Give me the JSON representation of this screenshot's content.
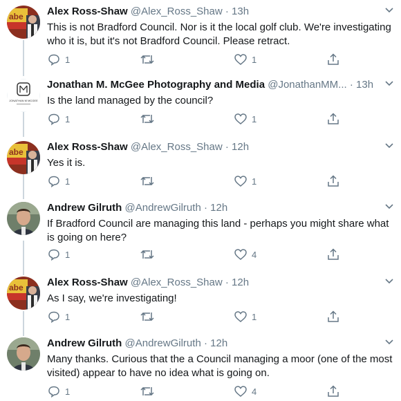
{
  "tweets": [
    {
      "name": "Alex Ross-Shaw",
      "handle": "@Alex_Ross_Shaw",
      "sep": "·",
      "time": "13h",
      "text": "This is not Bradford Council. Nor is it the local golf club. We're investigating who it is, but it's not Bradford Council. Please retract.",
      "replies": "1",
      "retweets": "",
      "likes": "1"
    },
    {
      "name": "Jonathan M. McGee Photography and Media",
      "handle": "@JonathanMM...",
      "sep": "·",
      "time": "13h",
      "logo_text": "JONATHAN M MCGEE",
      "text": "Is the land managed by the council?",
      "replies": "1",
      "retweets": "",
      "likes": "1"
    },
    {
      "name": "Alex Ross-Shaw",
      "handle": "@Alex_Ross_Shaw",
      "sep": "·",
      "time": "12h",
      "text": "Yes it is.",
      "replies": "1",
      "retweets": "",
      "likes": "1"
    },
    {
      "name": "Andrew Gilruth",
      "handle": "@AndrewGilruth",
      "sep": "·",
      "time": "12h",
      "text": "If Bradford Council are managing this land - perhaps you might share what is going on here?",
      "replies": "1",
      "retweets": "",
      "likes": "4"
    },
    {
      "name": "Alex Ross-Shaw",
      "handle": "@Alex_Ross_Shaw",
      "sep": "·",
      "time": "12h",
      "text": "As I say, we're investigating!",
      "replies": "1",
      "retweets": "",
      "likes": "1"
    },
    {
      "name": "Andrew Gilruth",
      "handle": "@AndrewGilruth",
      "sep": "·",
      "time": "12h",
      "text": "Many thanks. Curious that the a Council managing a moor (one of the most visited) appear to have no idea what is going on.",
      "replies": "1",
      "retweets": "",
      "likes": "4"
    }
  ],
  "icons": {
    "reply": "reply-icon",
    "retweet": "retweet-icon",
    "like": "heart-icon",
    "share": "share-icon",
    "more": "chevron-down-icon"
  },
  "colors": {
    "text": "#14171a",
    "secondary": "#657786",
    "thread": "#ccd6dd"
  }
}
